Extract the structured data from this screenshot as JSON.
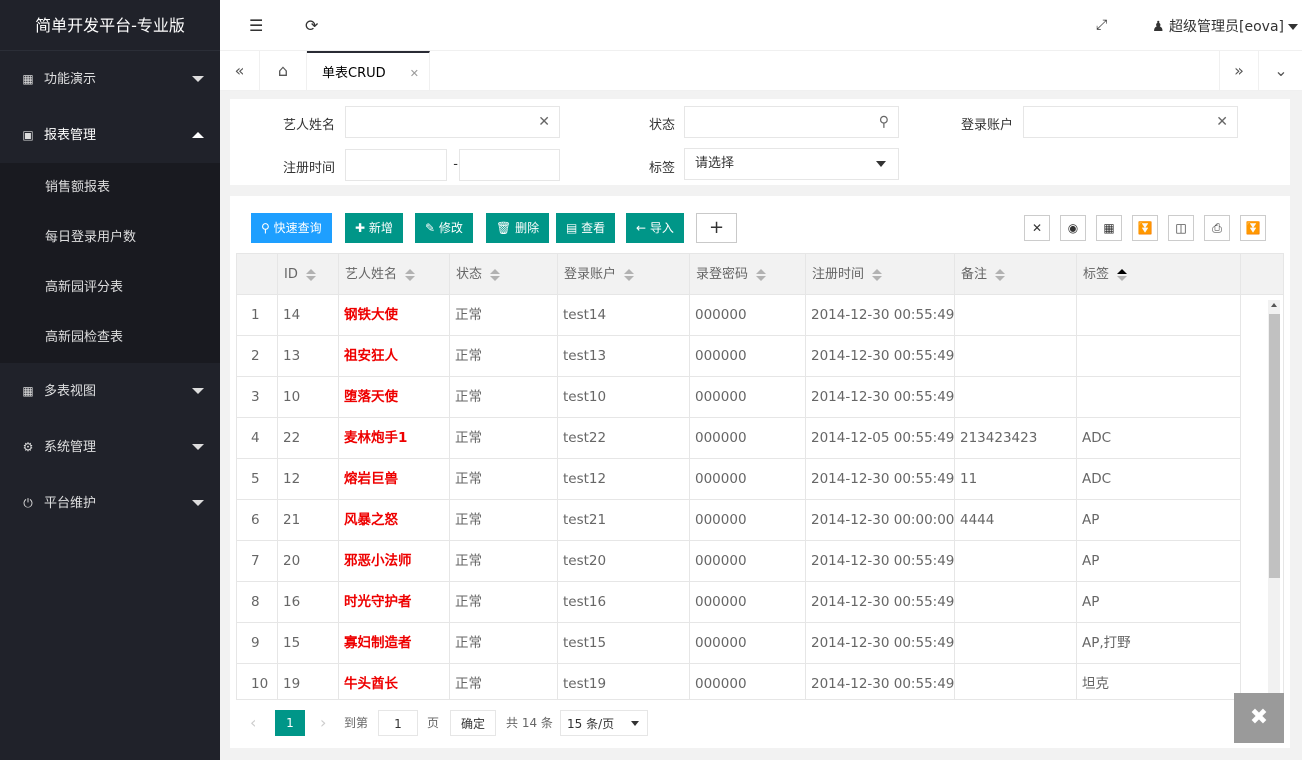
{
  "app": {
    "title": "简单开发平台-专业版"
  },
  "sidebar": {
    "menus": [
      {
        "label": "功能演示",
        "icon": "apps-icon",
        "open": false
      },
      {
        "label": "报表管理",
        "icon": "report-icon",
        "open": true,
        "children": [
          "销售额报表",
          "每日登录用户数",
          "高新园评分表",
          "高新园检查表"
        ]
      },
      {
        "label": "多表视图",
        "icon": "table-icon",
        "open": false
      },
      {
        "label": "系统管理",
        "icon": "gear-icon",
        "open": false
      },
      {
        "label": "平台维护",
        "icon": "maintenance-icon",
        "open": false
      }
    ]
  },
  "header": {
    "user": "超级管理员[eova]"
  },
  "tabs": {
    "active": "单表CRUD"
  },
  "search": {
    "artist_label": "艺人姓名",
    "status_label": "状态",
    "account_label": "登录账户",
    "regtime_label": "注册时间",
    "regtime_sep": "-",
    "tag_label": "标签",
    "tag_value": "请选择"
  },
  "toolbar": {
    "quick_query": "快速查询",
    "add": "新增",
    "edit": "修改",
    "delete": "删除",
    "view": "查看",
    "import": "导入",
    "plus": "+"
  },
  "table": {
    "columns": [
      "ID",
      "艺人姓名",
      "状态",
      "登录账户",
      "录登密码",
      "注册时间",
      "备注",
      "标签"
    ],
    "rows": [
      {
        "n": "1",
        "id": "14",
        "name": "钢铁大使",
        "status": "正常",
        "account": "test14",
        "pwd": "000000",
        "time": "2014-12-30 00:55:49",
        "note": "",
        "tag": ""
      },
      {
        "n": "2",
        "id": "13",
        "name": "祖安狂人",
        "status": "正常",
        "account": "test13",
        "pwd": "000000",
        "time": "2014-12-30 00:55:49",
        "note": "",
        "tag": ""
      },
      {
        "n": "3",
        "id": "10",
        "name": "堕落天使",
        "status": "正常",
        "account": "test10",
        "pwd": "000000",
        "time": "2014-12-30 00:55:49",
        "note": "",
        "tag": ""
      },
      {
        "n": "4",
        "id": "22",
        "name": "麦林炮手1",
        "status": "正常",
        "account": "test22",
        "pwd": "000000",
        "time": "2014-12-05 00:55:49",
        "note": "213423423",
        "tag": "ADC"
      },
      {
        "n": "5",
        "id": "12",
        "name": "熔岩巨兽",
        "status": "正常",
        "account": "test12",
        "pwd": "000000",
        "time": "2014-12-30 00:55:49",
        "note": "11",
        "tag": "ADC"
      },
      {
        "n": "6",
        "id": "21",
        "name": "风暴之怒",
        "status": "正常",
        "account": "test21",
        "pwd": "000000",
        "time": "2014-12-30 00:00:00",
        "note": "4444",
        "tag": "AP"
      },
      {
        "n": "7",
        "id": "20",
        "name": "邪恶小法师",
        "status": "正常",
        "account": "test20",
        "pwd": "000000",
        "time": "2014-12-30 00:55:49",
        "note": "",
        "tag": "AP"
      },
      {
        "n": "8",
        "id": "16",
        "name": "时光守护者",
        "status": "正常",
        "account": "test16",
        "pwd": "000000",
        "time": "2014-12-30 00:55:49",
        "note": "",
        "tag": "AP"
      },
      {
        "n": "9",
        "id": "15",
        "name": "寡妇制造者",
        "status": "正常",
        "account": "test15",
        "pwd": "000000",
        "time": "2014-12-30 00:55:49",
        "note": "",
        "tag": "AP,打野"
      },
      {
        "n": "10",
        "id": "19",
        "name": "牛头酋长",
        "status": "正常",
        "account": "test19",
        "pwd": "000000",
        "time": "2014-12-30 00:55:49",
        "note": "",
        "tag": "坦克"
      }
    ]
  },
  "pager": {
    "current": "1",
    "goto_label": "到第",
    "goto_value": "1",
    "page_label": "页",
    "confirm": "确定",
    "total": "共 14 条",
    "page_size": "15 条/页"
  }
}
